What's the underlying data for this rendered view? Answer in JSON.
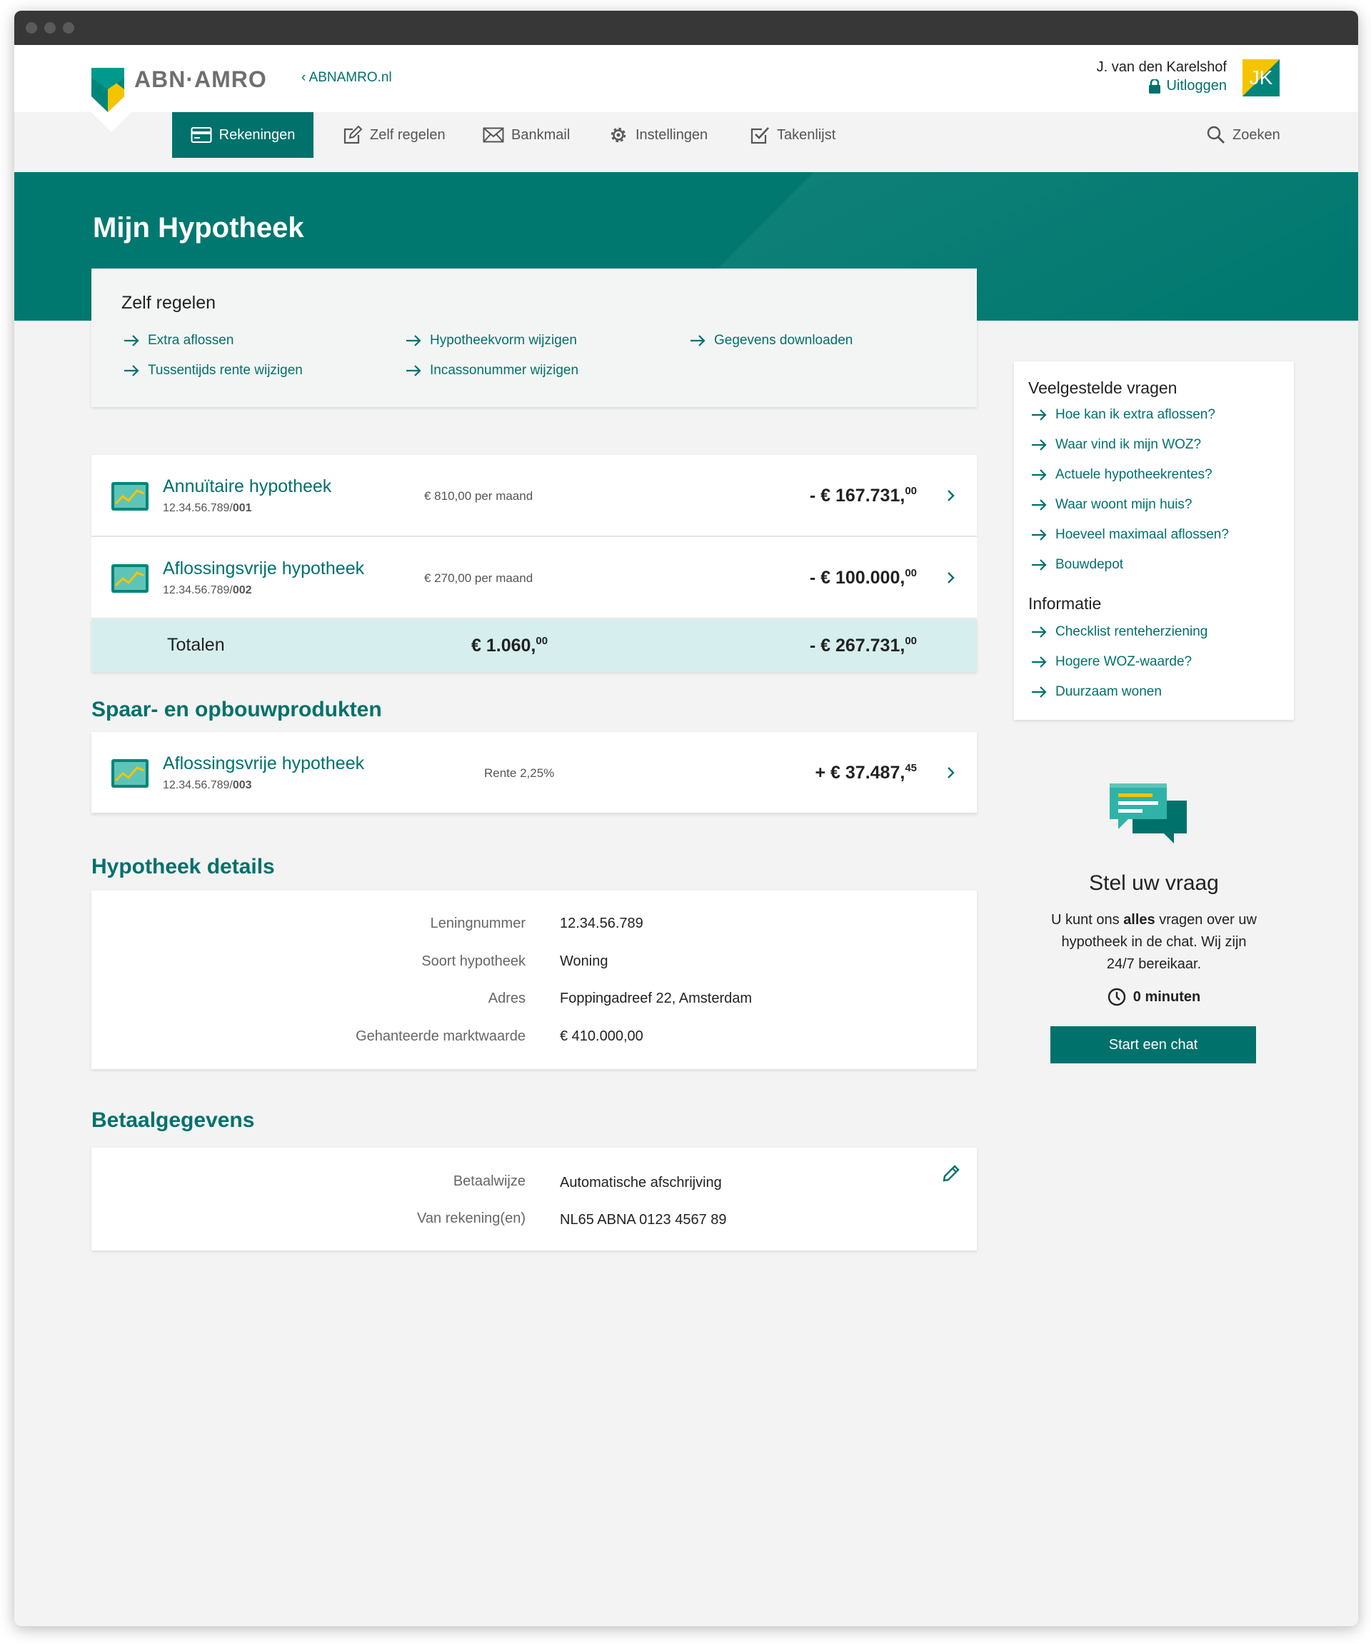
{
  "brand": {
    "name": "ABN·AMRO",
    "back_link": "ABNAMRO.nl"
  },
  "user": {
    "name": "J. van den Karelshof",
    "logout": "Uitloggen",
    "initials": "JK"
  },
  "nav": {
    "items": [
      {
        "label": "Rekeningen",
        "icon": "credit-card-icon",
        "active": true
      },
      {
        "label": "Zelf regelen",
        "icon": "edit-icon"
      },
      {
        "label": "Bankmail",
        "icon": "mail-icon"
      },
      {
        "label": "Instellingen",
        "icon": "gear-icon"
      },
      {
        "label": "Takenlijst",
        "icon": "checkbox-icon"
      }
    ],
    "search": "Zoeken"
  },
  "page": {
    "title": "Mijn Hypotheek"
  },
  "zelf_regelen": {
    "title": "Zelf regelen",
    "links": [
      "Extra aflossen",
      "Tussentijds rente wijzigen",
      "Hypotheekvorm wijzigen",
      "Incassonummer wijzigen",
      "Gegevens downloaden"
    ]
  },
  "accounts": [
    {
      "name": "Annuïtaire hypotheek",
      "number_prefix": "12.34.56.789/",
      "number_suffix": "001",
      "mid": "€ 810,00 per maand",
      "amount": "- € 167.731,",
      "cents": "00"
    },
    {
      "name": "Aflossingsvrije hypotheek",
      "number_prefix": "12.34.56.789/",
      "number_suffix": "002",
      "mid": "€ 270,00 per maand",
      "amount": "- € 100.000,",
      "cents": "00"
    }
  ],
  "totals": {
    "label": "Totalen",
    "monthly": "€ 1.060,",
    "monthly_cents": "00",
    "amount": "- € 267.731,",
    "cents": "00"
  },
  "savings": {
    "title": "Spaar- en opbouwprodukten",
    "item": {
      "name": "Aflossingsvrije hypotheek",
      "number_prefix": "12.34.56.789/",
      "number_suffix": "003",
      "mid": "Rente 2,25%",
      "amount": "+ € 37.487,",
      "cents": "45"
    }
  },
  "details": {
    "title": "Hypotheek details",
    "rows": [
      {
        "label": "Leningnummer",
        "value": "12.34.56.789"
      },
      {
        "label": "Soort hypotheek",
        "value": "Woning"
      },
      {
        "label": "Adres",
        "value": "Foppingadreef 22, Amsterdam"
      },
      {
        "label": "Gehanteerde marktwaarde",
        "value": "€ 410.000,00"
      }
    ]
  },
  "payment": {
    "title": "Betaalgegevens",
    "rows": [
      {
        "label": "Betaalwijze",
        "value": "Automatische afschrijving"
      },
      {
        "label": "Van rekening(en)",
        "value": "NL65 ABNA 0123 4567 89"
      }
    ]
  },
  "faq": {
    "title": "Veelgestelde vragen",
    "links": [
      "Hoe kan ik extra aflossen?",
      "Waar vind ik mijn WOZ?",
      "Actuele hypotheekrentes?",
      "Waar woont mijn huis?",
      "Hoeveel maximaal aflossen?",
      "Bouwdepot"
    ],
    "info_title": "Informatie",
    "info_links": [
      "Checklist renteherziening",
      "Hogere WOZ-waarde?",
      "Duurzaam wonen"
    ]
  },
  "chat": {
    "title": "Stel uw vraag",
    "text_1": "U kunt ons ",
    "text_bold": "alles",
    "text_2": " vragen over uw hypotheek in de chat. Wij zijn 24/7 bereikaar.",
    "wait": "0 minuten",
    "button": "Start een chat"
  },
  "colors": {
    "primary": "#00716b",
    "hero": "#00786f",
    "accent_yellow": "#f5c400",
    "totals_bg": "#d6eeee"
  }
}
